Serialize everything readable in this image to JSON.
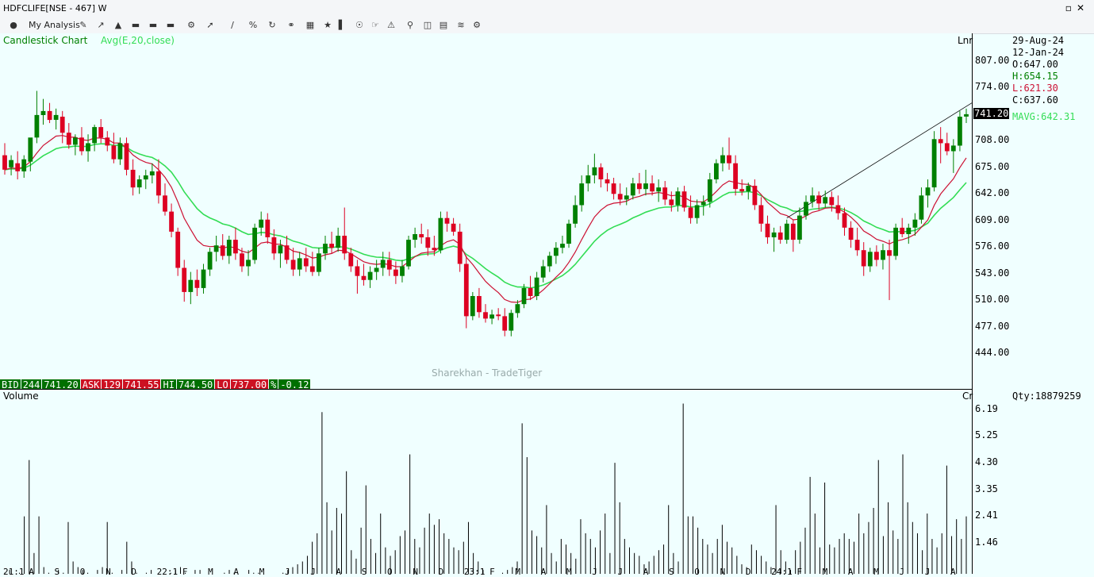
{
  "window": {
    "title": "HDFCLIFE[NSE - 467] W"
  },
  "toolbar": {
    "my_analysis": "My Analysis"
  },
  "chart": {
    "type_label": "Candlestick Chart",
    "indicator_label": "Avg(E,20,close)",
    "scale_mode": "Lnr",
    "volume_label": "Volume",
    "volume_scale_mode": "Cr",
    "watermark": "Sharekhan - TradeTiger",
    "price_ticks": [
      "807.00",
      "774.00",
      "741.20",
      "708.00",
      "675.00",
      "642.00",
      "609.00",
      "576.00",
      "543.00",
      "510.00",
      "477.00",
      "444.00"
    ],
    "volume_ticks": [
      "6.19",
      "5.25",
      "4.30",
      "3.35",
      "2.41",
      "1.46"
    ],
    "x_ticks": [
      "21:1",
      "A",
      "S",
      "O",
      "N",
      "D",
      "22:1",
      "F",
      "M",
      "A",
      "M",
      "J",
      "J",
      "A",
      "S",
      "O",
      "N",
      "D",
      "23:1",
      "F",
      "M",
      "A",
      "M",
      "J",
      "J",
      "A",
      "S",
      "O",
      "N",
      "D",
      "24:1",
      "F",
      "M",
      "A",
      "M",
      "J",
      "J",
      "A"
    ]
  },
  "info_panel": {
    "date1": "29-Aug-24",
    "date2": "12-Jan-24",
    "open": "O:647.00",
    "high": "H:654.15",
    "low": "L:621.30",
    "close": "C:637.60",
    "last_price": "741.20",
    "mavg": "MAVG:642.31",
    "qty": "Qty:18879259"
  },
  "quote_bar": {
    "bid_label": "BID",
    "bid_qty": "244",
    "bid_price": "741.20",
    "ask_label": "ASK",
    "ask_qty": "129",
    "ask_price": "741.55",
    "hi_label": "HI",
    "hi_value": "744.50",
    "lo_label": "LO",
    "lo_value": "737.00",
    "pct_label": "%",
    "pct_value": "-0.12"
  },
  "colors": {
    "up": "#008000",
    "down": "#dd0022",
    "ema": "#33dd55",
    "avg": "#cc1133",
    "bg": "#f0ffff"
  },
  "chart_data": {
    "type": "candlestick",
    "title": "Candlestick Chart",
    "ylim": [
      430,
      830
    ],
    "indicator": "Avg(E,20,close)",
    "candles": [
      {
        "o": 690,
        "h": 705,
        "l": 666,
        "c": 672
      },
      {
        "o": 675,
        "h": 690,
        "l": 665,
        "c": 684
      },
      {
        "o": 680,
        "h": 695,
        "l": 660,
        "c": 670
      },
      {
        "o": 670,
        "h": 690,
        "l": 662,
        "c": 685
      },
      {
        "o": 682,
        "h": 705,
        "l": 670,
        "c": 712
      },
      {
        "o": 712,
        "h": 770,
        "l": 705,
        "c": 740
      },
      {
        "o": 740,
        "h": 760,
        "l": 728,
        "c": 745
      },
      {
        "o": 745,
        "h": 755,
        "l": 730,
        "c": 734
      },
      {
        "o": 734,
        "h": 748,
        "l": 722,
        "c": 740
      },
      {
        "o": 738,
        "h": 745,
        "l": 705,
        "c": 718
      },
      {
        "o": 718,
        "h": 730,
        "l": 698,
        "c": 703
      },
      {
        "o": 703,
        "h": 716,
        "l": 690,
        "c": 712
      },
      {
        "o": 712,
        "h": 725,
        "l": 690,
        "c": 695
      },
      {
        "o": 695,
        "h": 716,
        "l": 682,
        "c": 705
      },
      {
        "o": 705,
        "h": 728,
        "l": 695,
        "c": 725
      },
      {
        "o": 725,
        "h": 735,
        "l": 705,
        "c": 712
      },
      {
        "o": 712,
        "h": 720,
        "l": 695,
        "c": 702
      },
      {
        "o": 702,
        "h": 718,
        "l": 680,
        "c": 685
      },
      {
        "o": 685,
        "h": 712,
        "l": 678,
        "c": 705
      },
      {
        "o": 705,
        "h": 712,
        "l": 665,
        "c": 672
      },
      {
        "o": 672,
        "h": 685,
        "l": 640,
        "c": 650
      },
      {
        "o": 650,
        "h": 665,
        "l": 642,
        "c": 660
      },
      {
        "o": 660,
        "h": 672,
        "l": 648,
        "c": 665
      },
      {
        "o": 665,
        "h": 680,
        "l": 655,
        "c": 670
      },
      {
        "o": 670,
        "h": 685,
        "l": 630,
        "c": 640
      },
      {
        "o": 640,
        "h": 655,
        "l": 615,
        "c": 620
      },
      {
        "o": 620,
        "h": 630,
        "l": 588,
        "c": 595
      },
      {
        "o": 595,
        "h": 600,
        "l": 540,
        "c": 550
      },
      {
        "o": 550,
        "h": 560,
        "l": 508,
        "c": 520
      },
      {
        "o": 520,
        "h": 545,
        "l": 505,
        "c": 535
      },
      {
        "o": 535,
        "h": 548,
        "l": 515,
        "c": 525
      },
      {
        "o": 525,
        "h": 555,
        "l": 518,
        "c": 548
      },
      {
        "o": 548,
        "h": 575,
        "l": 540,
        "c": 570
      },
      {
        "o": 570,
        "h": 590,
        "l": 558,
        "c": 578
      },
      {
        "o": 578,
        "h": 592,
        "l": 560,
        "c": 565
      },
      {
        "o": 565,
        "h": 590,
        "l": 555,
        "c": 585
      },
      {
        "o": 585,
        "h": 600,
        "l": 560,
        "c": 568
      },
      {
        "o": 568,
        "h": 575,
        "l": 545,
        "c": 552
      },
      {
        "o": 552,
        "h": 572,
        "l": 540,
        "c": 560
      },
      {
        "o": 560,
        "h": 605,
        "l": 555,
        "c": 600
      },
      {
        "o": 600,
        "h": 620,
        "l": 590,
        "c": 610
      },
      {
        "o": 610,
        "h": 618,
        "l": 580,
        "c": 588
      },
      {
        "o": 588,
        "h": 598,
        "l": 560,
        "c": 568
      },
      {
        "o": 568,
        "h": 585,
        "l": 550,
        "c": 578
      },
      {
        "o": 578,
        "h": 590,
        "l": 555,
        "c": 560
      },
      {
        "o": 560,
        "h": 575,
        "l": 540,
        "c": 548
      },
      {
        "o": 548,
        "h": 570,
        "l": 540,
        "c": 562
      },
      {
        "o": 562,
        "h": 575,
        "l": 545,
        "c": 552
      },
      {
        "o": 552,
        "h": 570,
        "l": 540,
        "c": 545
      },
      {
        "o": 545,
        "h": 575,
        "l": 540,
        "c": 568
      },
      {
        "o": 568,
        "h": 590,
        "l": 560,
        "c": 580
      },
      {
        "o": 580,
        "h": 595,
        "l": 568,
        "c": 575
      },
      {
        "o": 575,
        "h": 600,
        "l": 570,
        "c": 590
      },
      {
        "o": 590,
        "h": 625,
        "l": 560,
        "c": 568
      },
      {
        "o": 568,
        "h": 575,
        "l": 545,
        "c": 552
      },
      {
        "o": 552,
        "h": 560,
        "l": 518,
        "c": 540
      },
      {
        "o": 540,
        "h": 555,
        "l": 528,
        "c": 535
      },
      {
        "o": 535,
        "h": 552,
        "l": 525,
        "c": 545
      },
      {
        "o": 545,
        "h": 560,
        "l": 535,
        "c": 550
      },
      {
        "o": 550,
        "h": 570,
        "l": 540,
        "c": 560
      },
      {
        "o": 560,
        "h": 570,
        "l": 540,
        "c": 548
      },
      {
        "o": 548,
        "h": 558,
        "l": 530,
        "c": 540
      },
      {
        "o": 540,
        "h": 560,
        "l": 532,
        "c": 552
      },
      {
        "o": 552,
        "h": 590,
        "l": 548,
        "c": 585
      },
      {
        "o": 585,
        "h": 600,
        "l": 575,
        "c": 592
      },
      {
        "o": 592,
        "h": 605,
        "l": 580,
        "c": 588
      },
      {
        "o": 588,
        "h": 598,
        "l": 565,
        "c": 575
      },
      {
        "o": 575,
        "h": 590,
        "l": 565,
        "c": 572
      },
      {
        "o": 572,
        "h": 620,
        "l": 568,
        "c": 612
      },
      {
        "o": 612,
        "h": 620,
        "l": 595,
        "c": 605
      },
      {
        "o": 605,
        "h": 612,
        "l": 590,
        "c": 595
      },
      {
        "o": 595,
        "h": 605,
        "l": 545,
        "c": 555
      },
      {
        "o": 555,
        "h": 565,
        "l": 475,
        "c": 490
      },
      {
        "o": 490,
        "h": 520,
        "l": 485,
        "c": 515
      },
      {
        "o": 515,
        "h": 525,
        "l": 488,
        "c": 495
      },
      {
        "o": 495,
        "h": 505,
        "l": 482,
        "c": 487
      },
      {
        "o": 487,
        "h": 498,
        "l": 480,
        "c": 492
      },
      {
        "o": 492,
        "h": 500,
        "l": 485,
        "c": 490
      },
      {
        "o": 490,
        "h": 500,
        "l": 465,
        "c": 472
      },
      {
        "o": 472,
        "h": 498,
        "l": 465,
        "c": 494
      },
      {
        "o": 494,
        "h": 510,
        "l": 488,
        "c": 505
      },
      {
        "o": 505,
        "h": 530,
        "l": 500,
        "c": 525
      },
      {
        "o": 525,
        "h": 540,
        "l": 510,
        "c": 515
      },
      {
        "o": 515,
        "h": 545,
        "l": 510,
        "c": 538
      },
      {
        "o": 538,
        "h": 560,
        "l": 532,
        "c": 552
      },
      {
        "o": 552,
        "h": 570,
        "l": 545,
        "c": 565
      },
      {
        "o": 565,
        "h": 582,
        "l": 555,
        "c": 575
      },
      {
        "o": 575,
        "h": 590,
        "l": 568,
        "c": 580
      },
      {
        "o": 580,
        "h": 610,
        "l": 575,
        "c": 605
      },
      {
        "o": 605,
        "h": 640,
        "l": 600,
        "c": 628
      },
      {
        "o": 628,
        "h": 665,
        "l": 620,
        "c": 655
      },
      {
        "o": 655,
        "h": 678,
        "l": 645,
        "c": 665
      },
      {
        "o": 665,
        "h": 692,
        "l": 655,
        "c": 675
      },
      {
        "o": 675,
        "h": 680,
        "l": 650,
        "c": 660
      },
      {
        "o": 660,
        "h": 668,
        "l": 645,
        "c": 655
      },
      {
        "o": 655,
        "h": 662,
        "l": 635,
        "c": 642
      },
      {
        "o": 642,
        "h": 655,
        "l": 628,
        "c": 635
      },
      {
        "o": 635,
        "h": 650,
        "l": 628,
        "c": 640
      },
      {
        "o": 640,
        "h": 662,
        "l": 635,
        "c": 655
      },
      {
        "o": 655,
        "h": 668,
        "l": 642,
        "c": 648
      },
      {
        "o": 648,
        "h": 672,
        "l": 640,
        "c": 655
      },
      {
        "o": 655,
        "h": 665,
        "l": 640,
        "c": 645
      },
      {
        "o": 645,
        "h": 660,
        "l": 632,
        "c": 650
      },
      {
        "o": 650,
        "h": 658,
        "l": 628,
        "c": 635
      },
      {
        "o": 635,
        "h": 645,
        "l": 620,
        "c": 628
      },
      {
        "o": 628,
        "h": 650,
        "l": 620,
        "c": 645
      },
      {
        "o": 645,
        "h": 652,
        "l": 620,
        "c": 625
      },
      {
        "o": 625,
        "h": 640,
        "l": 605,
        "c": 612
      },
      {
        "o": 612,
        "h": 635,
        "l": 605,
        "c": 628
      },
      {
        "o": 628,
        "h": 640,
        "l": 615,
        "c": 632
      },
      {
        "o": 632,
        "h": 668,
        "l": 625,
        "c": 660
      },
      {
        "o": 660,
        "h": 685,
        "l": 655,
        "c": 680
      },
      {
        "o": 680,
        "h": 700,
        "l": 670,
        "c": 690
      },
      {
        "o": 690,
        "h": 712,
        "l": 672,
        "c": 680
      },
      {
        "o": 680,
        "h": 690,
        "l": 640,
        "c": 648
      },
      {
        "o": 648,
        "h": 660,
        "l": 640,
        "c": 645
      },
      {
        "o": 645,
        "h": 656,
        "l": 635,
        "c": 652
      },
      {
        "o": 652,
        "h": 660,
        "l": 622,
        "c": 628
      },
      {
        "o": 628,
        "h": 638,
        "l": 595,
        "c": 605
      },
      {
        "o": 605,
        "h": 615,
        "l": 580,
        "c": 588
      },
      {
        "o": 588,
        "h": 600,
        "l": 570,
        "c": 594
      },
      {
        "o": 594,
        "h": 602,
        "l": 580,
        "c": 585
      },
      {
        "o": 585,
        "h": 610,
        "l": 580,
        "c": 605
      },
      {
        "o": 605,
        "h": 610,
        "l": 570,
        "c": 585
      },
      {
        "o": 585,
        "h": 625,
        "l": 580,
        "c": 615
      },
      {
        "o": 615,
        "h": 640,
        "l": 610,
        "c": 632
      },
      {
        "o": 632,
        "h": 650,
        "l": 625,
        "c": 640
      },
      {
        "o": 640,
        "h": 645,
        "l": 622,
        "c": 630
      },
      {
        "o": 630,
        "h": 646,
        "l": 625,
        "c": 638
      },
      {
        "o": 638,
        "h": 645,
        "l": 620,
        "c": 628
      },
      {
        "o": 628,
        "h": 640,
        "l": 610,
        "c": 618
      },
      {
        "o": 618,
        "h": 625,
        "l": 590,
        "c": 600
      },
      {
        "o": 600,
        "h": 608,
        "l": 575,
        "c": 585
      },
      {
        "o": 585,
        "h": 600,
        "l": 565,
        "c": 572
      },
      {
        "o": 572,
        "h": 582,
        "l": 540,
        "c": 552
      },
      {
        "o": 552,
        "h": 575,
        "l": 545,
        "c": 570
      },
      {
        "o": 570,
        "h": 578,
        "l": 552,
        "c": 560
      },
      {
        "o": 560,
        "h": 580,
        "l": 548,
        "c": 572
      },
      {
        "o": 572,
        "h": 585,
        "l": 510,
        "c": 565
      },
      {
        "o": 565,
        "h": 605,
        "l": 560,
        "c": 600
      },
      {
        "o": 600,
        "h": 612,
        "l": 588,
        "c": 592
      },
      {
        "o": 592,
        "h": 605,
        "l": 580,
        "c": 600
      },
      {
        "o": 600,
        "h": 618,
        "l": 590,
        "c": 610
      },
      {
        "o": 610,
        "h": 650,
        "l": 605,
        "c": 640
      },
      {
        "o": 640,
        "h": 660,
        "l": 625,
        "c": 650
      },
      {
        "o": 650,
        "h": 720,
        "l": 645,
        "c": 710
      },
      {
        "o": 710,
        "h": 725,
        "l": 680,
        "c": 705
      },
      {
        "o": 705,
        "h": 718,
        "l": 690,
        "c": 695
      },
      {
        "o": 695,
        "h": 710,
        "l": 668,
        "c": 702
      },
      {
        "o": 702,
        "h": 745,
        "l": 695,
        "c": 738
      },
      {
        "o": 738,
        "h": 748,
        "l": 730,
        "c": 741
      }
    ],
    "volume": [
      0.4,
      0.5,
      0.3,
      0.4,
      2.4,
      4.4,
      1.1,
      2.4,
      0.6,
      0.4,
      0.3,
      0.5,
      0.4,
      2.2,
      0.8,
      0.6,
      0.5,
      0.4,
      0.3,
      0.5,
      0.6,
      2.2,
      0.4,
      0.3,
      0.5,
      1.5,
      0.8,
      0.4,
      0.3,
      0.4,
      0.5,
      0.3,
      0.2,
      0.3,
      0.4,
      0.5,
      0.6,
      0.4,
      0.3,
      0.5,
      0.5,
      0.3,
      0.2,
      0.3,
      0.3,
      0.4,
      0.5,
      0.4,
      0.3,
      0.3,
      0.5,
      0.4,
      0.4,
      0.3,
      0.3,
      0.2,
      0.3,
      0.4,
      0.5,
      0.6,
      0.7,
      0.8,
      1.0,
      1.5,
      1.8,
      6.1,
      2.9,
      1.9,
      2.7,
      2.5,
      4.0,
      1.2,
      0.9,
      2.0,
      3.5,
      1.6,
      1.1,
      2.5,
      1.3,
      1.0,
      1.2,
      1.7,
      1.9,
      4.6,
      1.6,
      1.3,
      2.0,
      2.5,
      2.1,
      2.3,
      1.8,
      1.6,
      1.3,
      1.2,
      1.5,
      2.2,
      1.1,
      0.8,
      0.5,
      0.3,
      0.2,
      0.3,
      0.4,
      0.5,
      0.6,
      0.8,
      5.7,
      4.5,
      1.9,
      1.7,
      1.3,
      2.8,
      1.1,
      0.8,
      1.6,
      1.4,
      1.1,
      0.9,
      2.3,
      1.8,
      1.6,
      1.3,
      1.9,
      2.5,
      1.1,
      4.3,
      2.9,
      1.6,
      1.3,
      1.1,
      1.0,
      0.7,
      0.8,
      1.0,
      1.2,
      1.4,
      2.8,
      1.1,
      0.8,
      6.4,
      2.4,
      2.4,
      2.0,
      1.6,
      1.4,
      1.1,
      1.6,
      2.1,
      1.5,
      1.3,
      1.0,
      0.7,
      0.6,
      1.4,
      1.2,
      1.0,
      0.8,
      0.6,
      2.8,
      1.2,
      0.8,
      0.5,
      1.2,
      1.5,
      2.0,
      3.8,
      2.5,
      1.3,
      3.6,
      1.4,
      1.3,
      1.6,
      1.8,
      1.6,
      1.5,
      2.5,
      1.8,
      2.2,
      2.7,
      4.4,
      1.7,
      2.9,
      1.9,
      1.6,
      4.6,
      2.9,
      2.2,
      1.8,
      1.2,
      2.5,
      1.6,
      1.3,
      1.8,
      4.2,
      1.7,
      2.3,
      1.6,
      2.4
    ]
  }
}
